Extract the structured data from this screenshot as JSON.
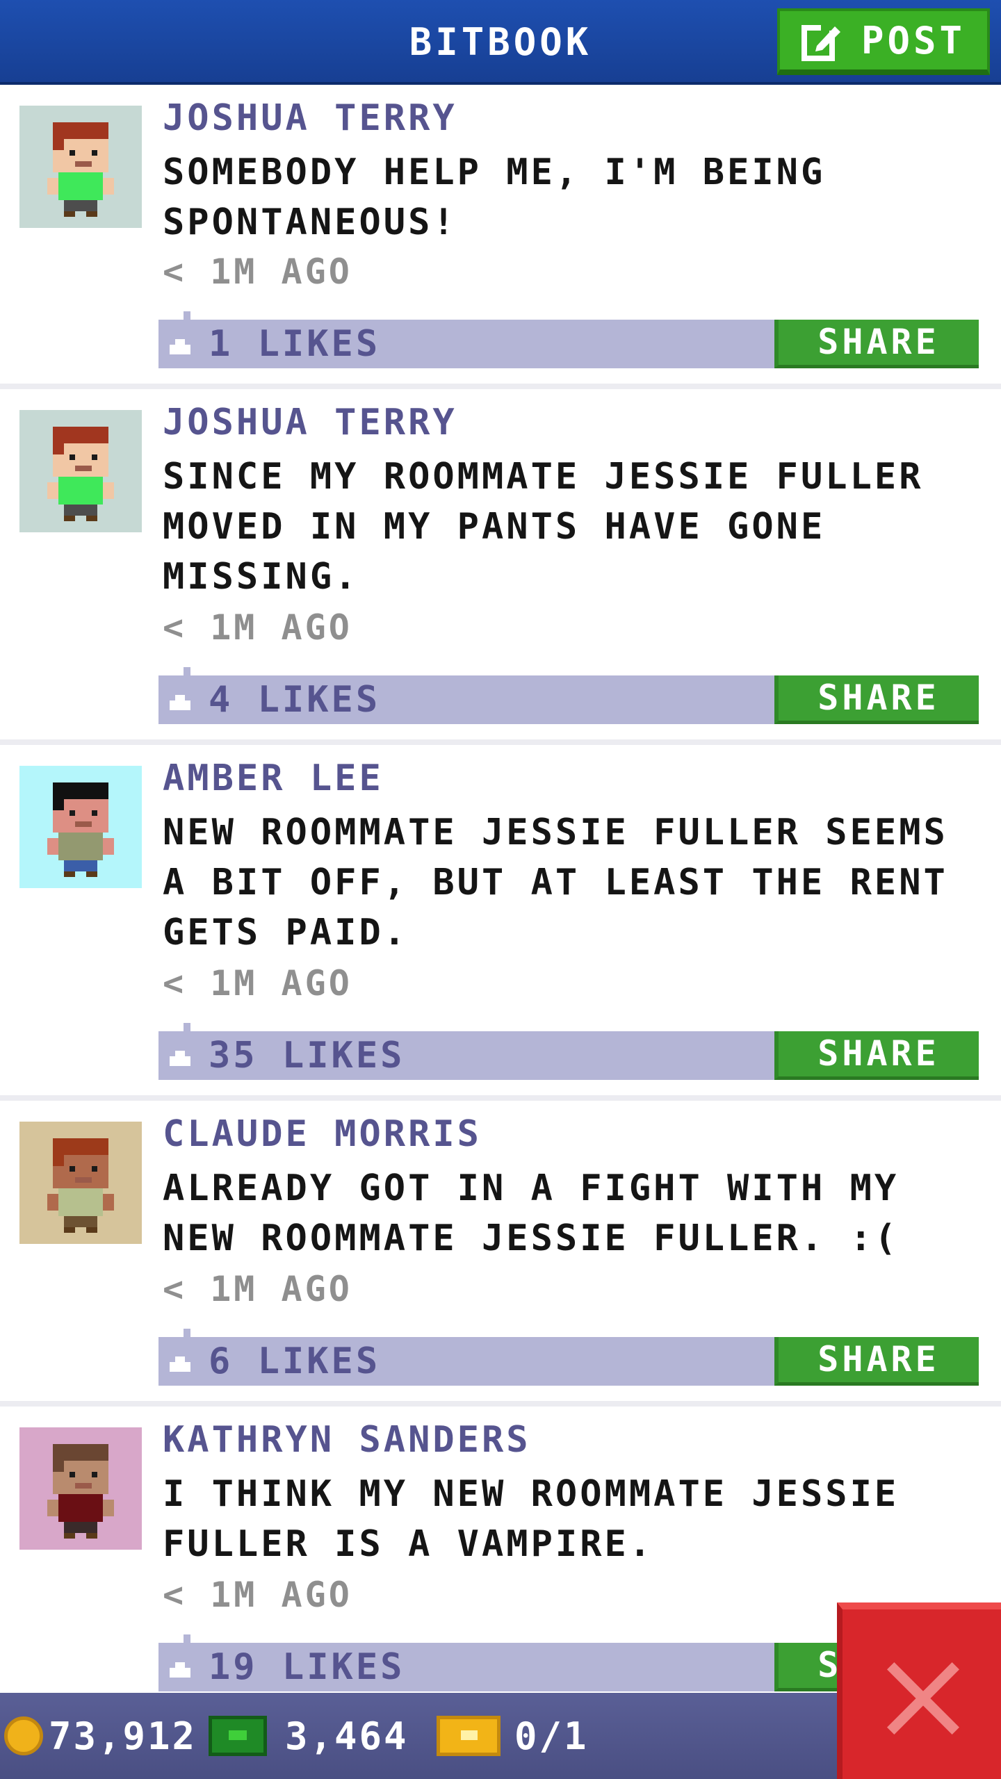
{
  "header": {
    "title": "BITBOOK",
    "post_label": "POST"
  },
  "posts": [
    {
      "author": "JOSHUA TERRY",
      "message": "SOMEBODY HELP ME, I'M BEING SPONTANEOUS!",
      "time": "< 1M AGO",
      "likes": "1 LIKES",
      "share_label": "SHARE",
      "avatar": {
        "bg": "#c6d9d4",
        "hair": "#a1361f",
        "skin": "#f1c7a5",
        "shirt": "#3fe85a",
        "pants": "#4d4d4d"
      }
    },
    {
      "author": "JOSHUA TERRY",
      "message": "SINCE MY ROOMMATE JESSIE FULLER MOVED IN MY PANTS HAVE GONE MISSING.",
      "time": "< 1M AGO",
      "likes": "4 LIKES",
      "share_label": "SHARE",
      "avatar": {
        "bg": "#c6d9d4",
        "hair": "#a1361f",
        "skin": "#f1c7a5",
        "shirt": "#3fe85a",
        "pants": "#4d4d4d"
      }
    },
    {
      "author": "AMBER LEE",
      "message": "NEW ROOMMATE JESSIE FULLER SEEMS A BIT OFF, BUT AT LEAST THE RENT GETS PAID.",
      "time": "< 1M AGO",
      "likes": "35 LIKES",
      "share_label": "SHARE",
      "avatar": {
        "bg": "#b4f6fb",
        "hair": "#111111",
        "skin": "#dd8f84",
        "shirt": "#939970",
        "pants": "#3b5ea8"
      }
    },
    {
      "author": "CLAUDE MORRIS",
      "message": "ALREADY GOT IN A FIGHT WITH MY NEW ROOMMATE JESSIE FULLER. :(",
      "time": "< 1M AGO",
      "likes": "6 LIKES",
      "share_label": "SHARE",
      "avatar": {
        "bg": "#d6c49b",
        "hair": "#9d3a1a",
        "skin": "#b06a4c",
        "shirt": "#b6c08e",
        "pants": "#6d5232"
      }
    },
    {
      "author": "KATHRYN SANDERS",
      "message": "I THINK MY NEW ROOMMATE JESSIE FULLER IS A VAMPIRE.",
      "time": "< 1M AGO",
      "likes": "19 LIKES",
      "share_label": "SHARE",
      "avatar": {
        "bg": "#d8a7c9",
        "hair": "#6a4632",
        "skin": "#b98b6e",
        "shirt": "#6a0f14",
        "pants": "#3a2a2a"
      }
    }
  ],
  "status": {
    "coins": "73,912",
    "bux": "3,464",
    "tickets": "0/1"
  },
  "colors": {
    "header": "#1e4fb0",
    "accent_green": "#3bb025",
    "like_bar": "#b4b5d6",
    "author_text": "#56548f",
    "close_red": "#d8262b"
  },
  "icons": {
    "post": "edit-icon",
    "like": "thumbs-up-icon",
    "coin": "coin-icon",
    "bux": "bux-icon",
    "ticket": "ticket-icon",
    "close": "close-icon"
  }
}
